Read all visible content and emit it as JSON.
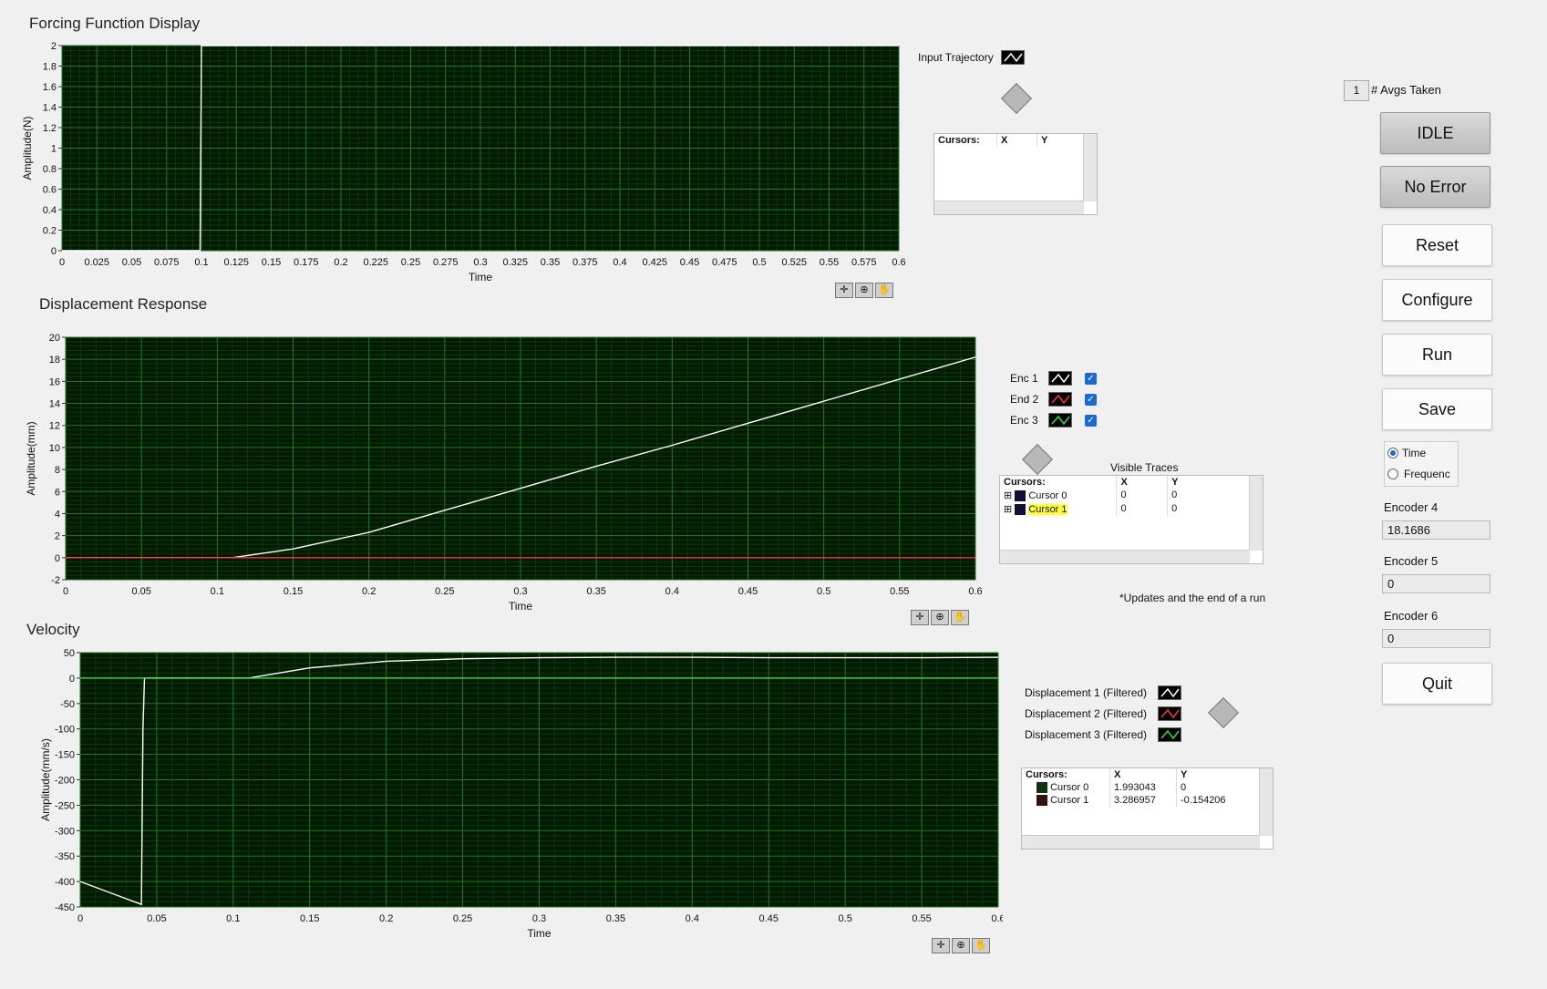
{
  "forcing": {
    "title": "Forcing Function Display",
    "ylabel": "Amplitude(N)",
    "xlabel": "Time",
    "legend_label": "Input Trajectory",
    "cursor_headers": [
      "Cursors:",
      "X",
      "Y"
    ]
  },
  "displacement": {
    "title": "Displacement Response",
    "ylabel": "Amplitude(mm)",
    "xlabel": "Time",
    "legend": [
      {
        "label": "Enc 1",
        "color": "#ffffff",
        "checked": "✓"
      },
      {
        "label": "End 2",
        "color": "#ff3030",
        "checked": "✓"
      },
      {
        "label": "Enc 3",
        "color": "#30e030",
        "checked": "✓"
      }
    ],
    "visible_traces_label": "Visible Traces",
    "cursor_headers": [
      "Cursors:",
      "X",
      "Y"
    ],
    "cursors": [
      {
        "name": "Cursor 0",
        "x": "0",
        "y": "0"
      },
      {
        "name": "Cursor 1",
        "x": "0",
        "y": "0"
      }
    ],
    "note": "*Updates and the end of a run"
  },
  "velocity": {
    "title": "Velocity",
    "ylabel": "Amplitude(mm/s)",
    "xlabel": "Time",
    "legend": [
      {
        "label": "Displacement 1 (Filtered)",
        "color": "#ffffff"
      },
      {
        "label": "Displacement 2 (Filtered)",
        "color": "#ff3030"
      },
      {
        "label": "Displacement 3 (Filtered)",
        "color": "#30e030"
      }
    ],
    "cursor_headers": [
      "Cursors:",
      "X",
      "Y"
    ],
    "cursors": [
      {
        "name": "Cursor 0",
        "x": "1.993043",
        "y": "0"
      },
      {
        "name": "Cursor 1",
        "x": "3.286957",
        "y": "-0.154206"
      }
    ]
  },
  "controls": {
    "avgs_value": "1",
    "avgs_label": "# Avgs Taken",
    "state_label": "IDLE",
    "error_label": "No Error",
    "reset_label": "Reset",
    "configure_label": "Configure",
    "run_label": "Run",
    "save_label": "Save",
    "quit_label": "Quit",
    "mode_options": [
      "Time",
      "Frequenc"
    ],
    "mode_selected": "Time",
    "encoder4_label": "Encoder 4",
    "encoder4_value": "18.1686",
    "encoder5_label": "Encoder 5",
    "encoder5_value": "0",
    "encoder6_label": "Encoder 6",
    "encoder6_value": "0"
  },
  "chart_data": [
    {
      "type": "line",
      "title": "Forcing Function Display",
      "xlabel": "Time",
      "ylabel": "Amplitude(N)",
      "xlim": [
        0,
        0.6
      ],
      "ylim": [
        0,
        2
      ],
      "x_ticks": [
        0,
        0.025,
        0.05,
        0.075,
        0.1,
        0.125,
        0.15,
        0.175,
        0.2,
        0.225,
        0.25,
        0.275,
        0.3,
        0.325,
        0.35,
        0.375,
        0.4,
        0.425,
        0.45,
        0.475,
        0.5,
        0.525,
        0.55,
        0.575,
        0.6
      ],
      "y_ticks": [
        0,
        0.2,
        0.4,
        0.6,
        0.8,
        1,
        1.2,
        1.4,
        1.6,
        1.8,
        2
      ],
      "grid": true,
      "series": [
        {
          "name": "Input Trajectory",
          "color": "#ffffff",
          "x": [
            0,
            0.099,
            0.1,
            0.6
          ],
          "y": [
            0,
            0,
            2,
            2
          ]
        }
      ]
    },
    {
      "type": "line",
      "title": "Displacement Response",
      "xlabel": "Time",
      "ylabel": "Amplitude(mm)",
      "xlim": [
        0,
        0.6
      ],
      "ylim": [
        -2,
        20
      ],
      "x_ticks": [
        0,
        0.05,
        0.1,
        0.15,
        0.2,
        0.25,
        0.3,
        0.35,
        0.4,
        0.45,
        0.5,
        0.55,
        0.6
      ],
      "y_ticks": [
        -2,
        0,
        2,
        4,
        6,
        8,
        10,
        12,
        14,
        16,
        18,
        20
      ],
      "grid": true,
      "series": [
        {
          "name": "Enc 1",
          "color": "#ffffff",
          "x": [
            0,
            0.11,
            0.15,
            0.2,
            0.25,
            0.3,
            0.35,
            0.4,
            0.45,
            0.5,
            0.55,
            0.6
          ],
          "y": [
            0,
            0,
            0.8,
            2.3,
            4.3,
            6.3,
            8.3,
            10.2,
            12.2,
            14.2,
            16.2,
            18.2
          ]
        },
        {
          "name": "End 2",
          "color": "#ff3030",
          "x": [
            0,
            0.6
          ],
          "y": [
            0,
            0
          ]
        }
      ]
    },
    {
      "type": "line",
      "title": "Velocity",
      "xlabel": "Time",
      "ylabel": "Amplitude(mm/s)",
      "xlim": [
        0,
        0.6
      ],
      "ylim": [
        -450,
        50
      ],
      "x_ticks": [
        0,
        0.05,
        0.1,
        0.15,
        0.2,
        0.25,
        0.3,
        0.35,
        0.4,
        0.45,
        0.5,
        0.55,
        0.6
      ],
      "y_ticks": [
        -450,
        -400,
        -350,
        -300,
        -250,
        -200,
        -150,
        -100,
        -50,
        0,
        50
      ],
      "grid": true,
      "series": [
        {
          "name": "Displacement 1 (Filtered)",
          "color": "#ffffff",
          "x": [
            0,
            0.04,
            0.041,
            0.042,
            0.11,
            0.15,
            0.2,
            0.25,
            0.3,
            0.35,
            0.4,
            0.45,
            0.5,
            0.55,
            0.6
          ],
          "y": [
            -400,
            -445,
            -100,
            0,
            0,
            20,
            33,
            38,
            40,
            41,
            41,
            40,
            40,
            40,
            41
          ]
        },
        {
          "name": "Displacement 3 (Filtered)",
          "color": "#30e030",
          "x": [
            0,
            0.6
          ],
          "y": [
            0,
            0
          ]
        }
      ]
    }
  ]
}
